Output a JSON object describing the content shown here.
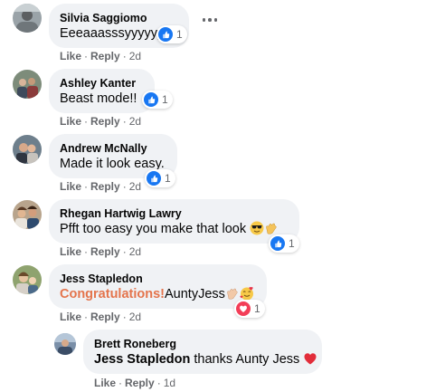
{
  "comments": [
    {
      "author": "Silvia Saggiomo",
      "text": "Eeeaaasssyyyyyy",
      "like": "Like",
      "reply": "Reply",
      "time": "2d",
      "reaction_count": "1",
      "reaction_type": "like-icon"
    },
    {
      "author": "Ashley Kanter",
      "text": "Beast mode!!",
      "like": "Like",
      "reply": "Reply",
      "time": "2d",
      "reaction_count": "1",
      "reaction_type": "like-icon"
    },
    {
      "author": "Andrew McNally",
      "text": "Made it look easy.",
      "like": "Like",
      "reply": "Reply",
      "time": "2d",
      "reaction_count": "1",
      "reaction_type": "like-icon"
    },
    {
      "author": "Rhegan Hartwig Lawry",
      "text": "Pfft too easy you make that look",
      "emojis": [
        "sunglasses-face-emoji",
        "clapping-hands-emoji"
      ],
      "like": "Like",
      "reply": "Reply",
      "time": "2d",
      "reaction_count": "1",
      "reaction_type": "like-icon"
    },
    {
      "author": "Jess Stapledon",
      "text_highlight": "Congratulations!",
      "text": "AuntyJess",
      "emojis": [
        "clapping-hands-emoji",
        "smiling-face-with-hearts-emoji"
      ],
      "like": "Like",
      "reply": "Reply",
      "time": "2d",
      "reaction_count": "1",
      "reaction_type": "love-icon"
    }
  ],
  "reply": {
    "author": "Brett Roneberg",
    "mention": "Jess Stapledon",
    "text": " thanks Aunty Jess",
    "emojis": [
      "red-heart-emoji"
    ],
    "like": "Like",
    "reply": "Reply",
    "time": "1d"
  },
  "colors": {
    "bubble": "#f0f2f5",
    "like_blue": "#1877f2",
    "love_red": "#f33e58",
    "highlight_orange": "#e4744c",
    "meta_gray": "#65676b"
  }
}
